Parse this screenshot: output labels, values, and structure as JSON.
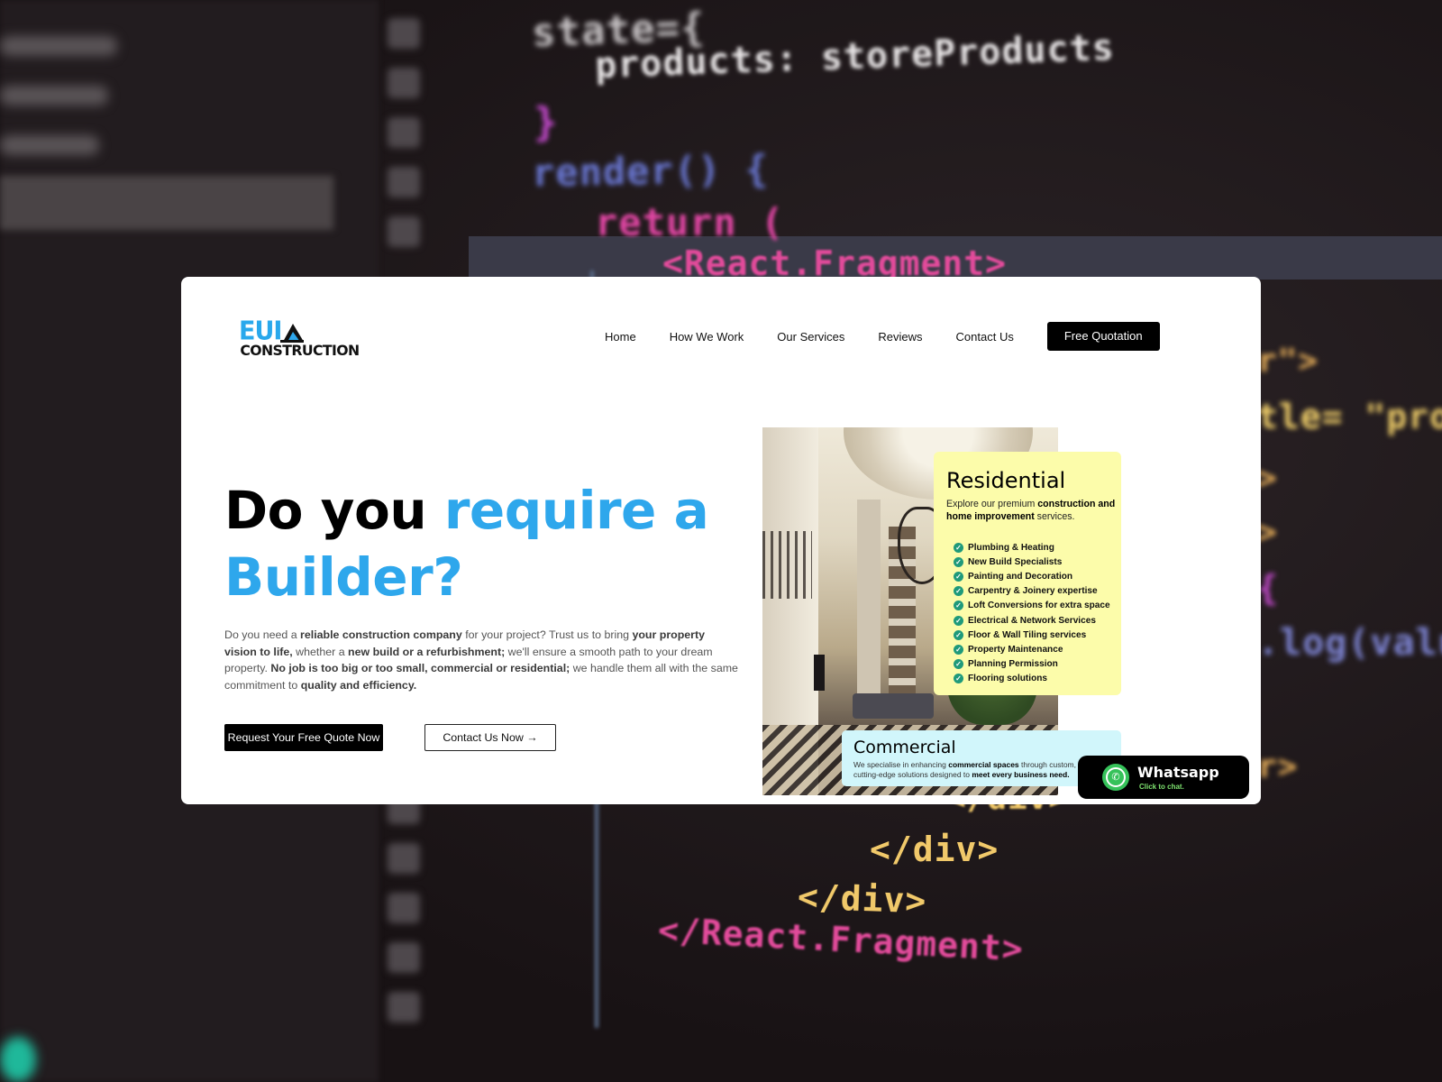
{
  "backdrop": {
    "code_lines": [
      {
        "text": "state={",
        "color": "#c7c3c5"
      },
      {
        "text": "products: storeProducts",
        "color": "#e9e6e7"
      },
      {
        "text": "}",
        "color": "#c84bd1"
      },
      {
        "text": "render() {",
        "color": "#6b79d6"
      },
      {
        "text": "return (",
        "color": "#e046a3"
      },
      {
        "text": "<React.Fragment>",
        "color": "#e24b9b"
      },
      {
        "text": "r\">",
        "color": "#e9b05a"
      },
      {
        "text": "tle= \"pro",
        "color": "#f2d06a"
      },
      {
        "text": ">",
        "color": "#e9b05a"
      },
      {
        "text": ">",
        "color": "#e9b05a"
      },
      {
        "text": "{",
        "color": "#c84bd1"
      },
      {
        "text": ".log(valu",
        "color": "#7f86d6"
      },
      {
        "text": "r>",
        "color": "#e9b05a"
      },
      {
        "text": "</div>",
        "color": "#f1c96a"
      },
      {
        "text": "</div>",
        "color": "#f1c96a"
      },
      {
        "text": "</div>",
        "color": "#f1c96a"
      },
      {
        "text": "</React.Fragment>",
        "color": "#e24b9b"
      }
    ]
  },
  "site": {
    "logo": {
      "top": "EUI",
      "bottom": "CONSTRUCTION"
    },
    "nav": {
      "items": [
        "Home",
        "How We Work",
        "Our Services",
        "Reviews",
        "Contact Us"
      ],
      "cta": "Free Quotation"
    },
    "hero": {
      "title_part1": "Do you ",
      "title_part2": "require a Builder?",
      "body": [
        {
          "t": "Do you need a ",
          "b": false
        },
        {
          "t": "reliable construction company",
          "b": true
        },
        {
          "t": " for your project? Trust us to bring ",
          "b": false
        },
        {
          "t": "your property vision to life,",
          "b": true
        },
        {
          "t": " whether a ",
          "b": false
        },
        {
          "t": "new build or a refurbishment;",
          "b": true
        },
        {
          "t": " we'll ensure a smooth path to your dream property. ",
          "b": false
        },
        {
          "t": "No job is too big or too small, commercial or residential;",
          "b": true
        },
        {
          "t": " we handle them all with the same commitment to ",
          "b": false
        },
        {
          "t": "quality and efficiency.",
          "b": true
        }
      ],
      "primary_button": "Request Your Free Quote Now",
      "secondary_button": "Contact Us Now",
      "secondary_arrow": "→"
    },
    "residential": {
      "title": "Residential",
      "sub": [
        {
          "t": "Explore our premium ",
          "b": false
        },
        {
          "t": "construction and home improvement",
          "b": true
        },
        {
          "t": " services.",
          "b": false
        }
      ],
      "check_glyph": "✓",
      "items": [
        "Plumbing & Heating",
        "New Build Specialists",
        "Painting and Decoration",
        "Carpentry & Joinery expertise",
        "Loft Conversions for extra space",
        "Electrical & Network Services",
        "Floor & Wall Tiling services",
        "Property Maintenance",
        "Planning Permission",
        "Flooring solutions"
      ]
    },
    "commercial": {
      "title": "Commercial",
      "sub": [
        {
          "t": "We specialise in enhancing ",
          "b": false
        },
        {
          "t": "commercial spaces",
          "b": true
        },
        {
          "t": " through custom,",
          "b": false
        },
        {
          "br": true
        },
        {
          "t": "cutting-edge solutions designed to ",
          "b": false
        },
        {
          "t": "meet every business need.",
          "b": true
        }
      ]
    },
    "whatsapp": {
      "title": "Whatsapp",
      "sub": "Click to chat.",
      "icon_glyph": "✆"
    }
  }
}
